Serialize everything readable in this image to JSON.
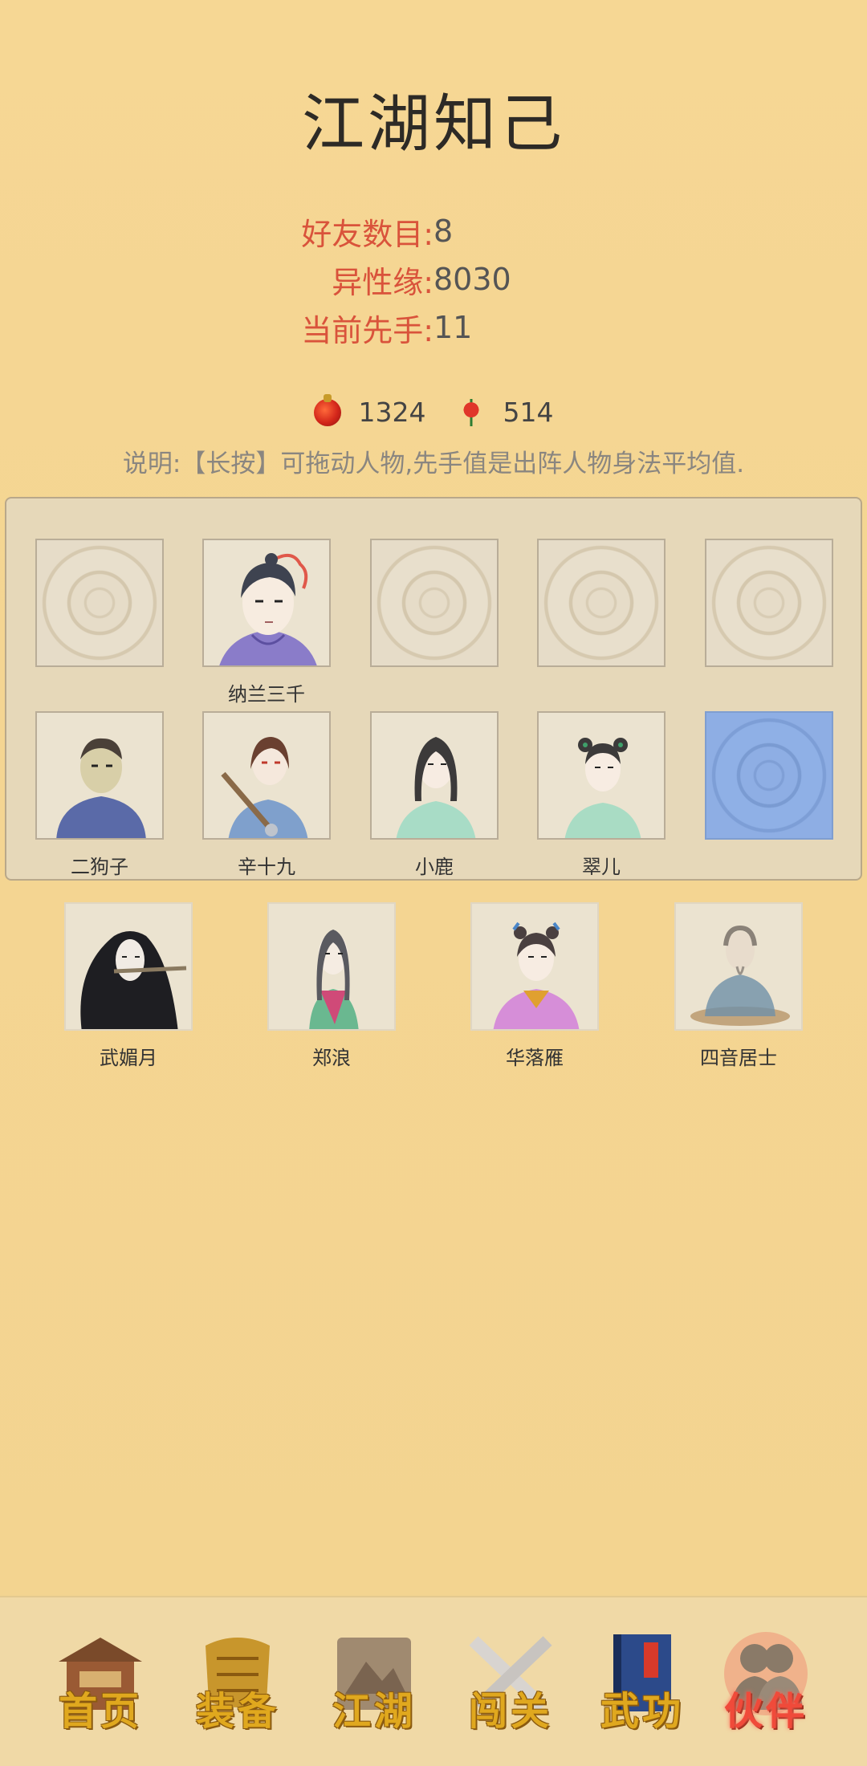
{
  "page": {
    "title": "江湖知己"
  },
  "stats": [
    {
      "label": "好友数目:",
      "value": "8"
    },
    {
      "label": "异性缘:",
      "value": "8030"
    },
    {
      "label": "当前先手:",
      "value": "11"
    }
  ],
  "currency": {
    "gourd": "1324",
    "rose": "514"
  },
  "description": "说明:【长按】可拖动人物,先手值是出阵人物身法平均值.",
  "team": {
    "row1": [
      {
        "name": "",
        "state": "empty"
      },
      {
        "name": "纳兰三千",
        "state": "filled",
        "icon": "nalan-portrait"
      },
      {
        "name": "",
        "state": "empty"
      },
      {
        "name": "",
        "state": "empty"
      },
      {
        "name": "",
        "state": "empty"
      }
    ],
    "row2": [
      {
        "name": "二狗子",
        "state": "filled",
        "icon": "ergouzi-portrait"
      },
      {
        "name": "辛十九",
        "state": "filled",
        "icon": "xinshijiu-portrait"
      },
      {
        "name": "小鹿",
        "state": "filled",
        "icon": "xiaolu-portrait"
      },
      {
        "name": "翠儿",
        "state": "filled",
        "icon": "cuier-portrait"
      },
      {
        "name": "",
        "state": "selected"
      }
    ]
  },
  "bench": [
    {
      "name": "武媚月",
      "icon": "wumeiyue-portrait"
    },
    {
      "name": "郑浪",
      "icon": "zhenglang-portrait"
    },
    {
      "name": "华落雁",
      "icon": "hualuoyan-portrait"
    },
    {
      "name": "四音居士",
      "icon": "siyinjushi-portrait"
    }
  ],
  "nav": [
    {
      "label": "首页",
      "icon": "house-icon"
    },
    {
      "label": "装备",
      "icon": "armor-icon"
    },
    {
      "label": "江湖",
      "icon": "scroll-icon"
    },
    {
      "label": "闯关",
      "icon": "swords-icon"
    },
    {
      "label": "武功",
      "icon": "book-icon"
    },
    {
      "label": "伙伴",
      "icon": "partners-icon",
      "active": true
    }
  ],
  "colors": {
    "accent_red": "#d9533b",
    "panel_bg": "#e6d8b9",
    "selected_slot": "#8eaee4"
  }
}
